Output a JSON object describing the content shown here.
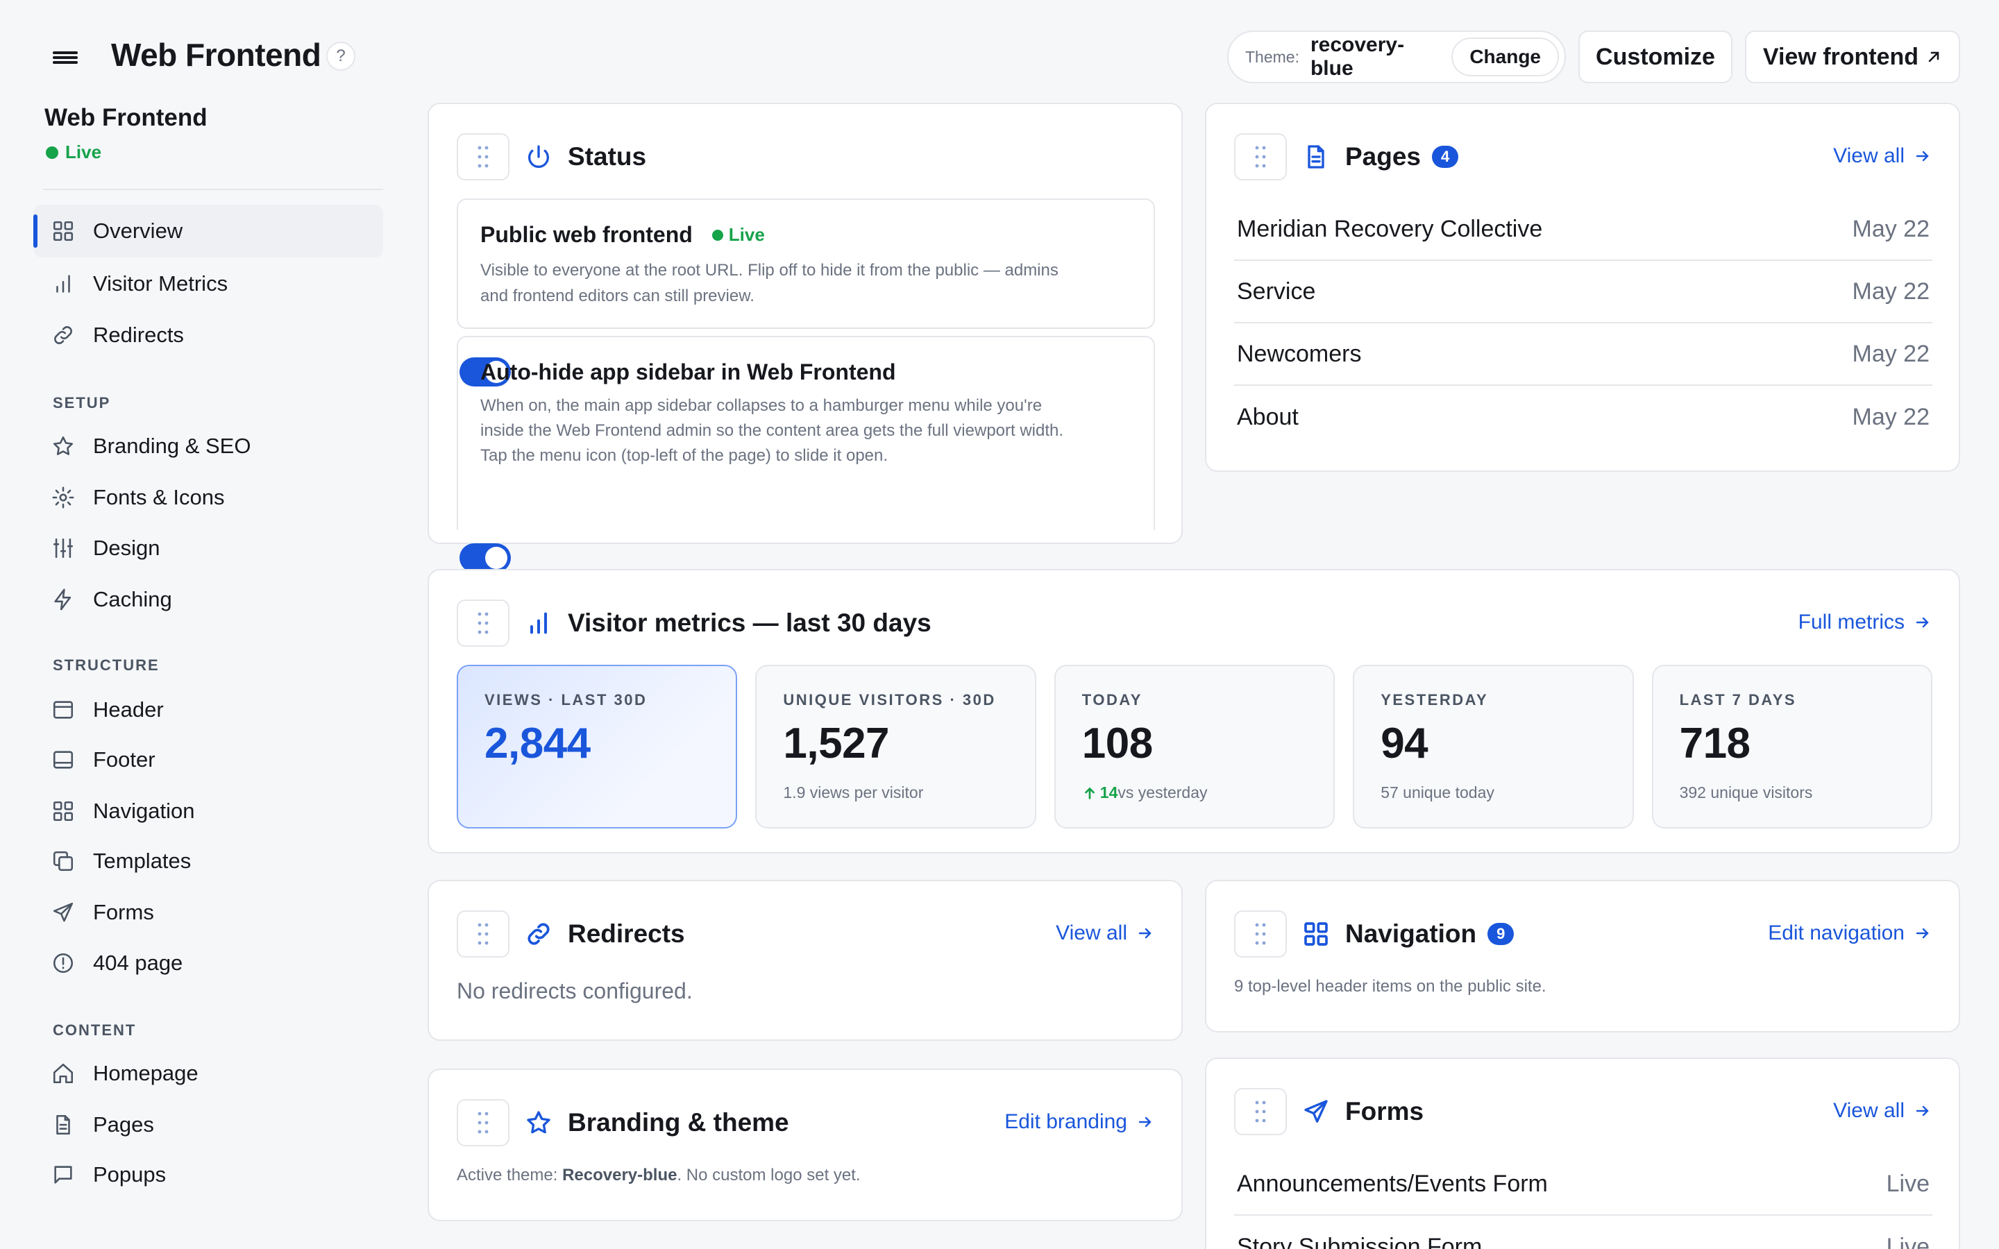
{
  "header": {
    "title": "Web Frontend",
    "help": "?",
    "theme_label": "Theme:",
    "theme_value": "recovery-blue",
    "change": "Change",
    "customize": "Customize",
    "view_frontend": "View frontend"
  },
  "sidebar": {
    "title": "Web Frontend",
    "status": "Live",
    "items": [
      {
        "label": "Overview",
        "icon": "grid-icon"
      },
      {
        "label": "Visitor Metrics",
        "icon": "bar-chart-icon"
      },
      {
        "label": "Redirects",
        "icon": "link-icon"
      }
    ],
    "setup_heading": "SETUP",
    "setup": [
      {
        "label": "Branding & SEO",
        "icon": "star-icon"
      },
      {
        "label": "Fonts & Icons",
        "icon": "gear-icon"
      },
      {
        "label": "Design",
        "icon": "sliders-icon"
      },
      {
        "label": "Caching",
        "icon": "bolt-icon"
      }
    ],
    "structure_heading": "STRUCTURE",
    "structure": [
      {
        "label": "Header",
        "icon": "header-icon"
      },
      {
        "label": "Footer",
        "icon": "footer-icon"
      },
      {
        "label": "Navigation",
        "icon": "grid-icon"
      },
      {
        "label": "Templates",
        "icon": "copy-icon"
      },
      {
        "label": "Forms",
        "icon": "send-icon"
      },
      {
        "label": "404 page",
        "icon": "alert-icon"
      }
    ],
    "content_heading": "CONTENT",
    "content": [
      {
        "label": "Homepage",
        "icon": "home-icon"
      },
      {
        "label": "Pages",
        "icon": "document-icon"
      },
      {
        "label": "Popups",
        "icon": "message-icon"
      }
    ]
  },
  "status_card": {
    "title": "Status",
    "items": [
      {
        "title": "Public web frontend",
        "badge": "Live",
        "desc": "Visible to everyone at the root URL. Flip off to hide it from the public — admins and frontend editors can still preview.",
        "on": true
      },
      {
        "title": "Auto-hide app sidebar in Web Frontend",
        "desc": "When on, the main app sidebar collapses to a hamburger menu while you're inside the Web Frontend admin so the content area gets the full viewport width. Tap the menu icon (top-left of the page) to slide it open.",
        "on": true
      }
    ]
  },
  "pages_card": {
    "title": "Pages",
    "count": "4",
    "link": "View all",
    "rows": [
      {
        "name": "Meridian Recovery Collective",
        "date": "May 22"
      },
      {
        "name": "Service",
        "date": "May 22"
      },
      {
        "name": "Newcomers",
        "date": "May 22"
      },
      {
        "name": "About",
        "date": "May 22"
      }
    ]
  },
  "metrics_card": {
    "title": "Visitor metrics — last 30 days",
    "link": "Full metrics",
    "tiles": [
      {
        "k": "VIEWS · LAST 30D",
        "v": "2,844",
        "s": ""
      },
      {
        "k": "UNIQUE VISITORS · 30D",
        "v": "1,527",
        "s": "1.9 views per visitor"
      },
      {
        "k": "TODAY",
        "v": "108",
        "delta": "14",
        "s": "vs yesterday"
      },
      {
        "k": "YESTERDAY",
        "v": "94",
        "s": "57 unique today"
      },
      {
        "k": "LAST 7 DAYS",
        "v": "718",
        "s": "392 unique visitors"
      }
    ]
  },
  "redirects_card": {
    "title": "Redirects",
    "link": "View all",
    "empty": "No redirects configured."
  },
  "navigation_card": {
    "title": "Navigation",
    "count": "9",
    "link": "Edit navigation",
    "desc": "9 top-level header items on the public site."
  },
  "branding_card": {
    "title": "Branding & theme",
    "link": "Edit branding",
    "desc_prefix": "Active theme: ",
    "theme": "Recovery-blue",
    "desc_suffix": ". No custom logo set yet."
  },
  "forms_card": {
    "title": "Forms",
    "link": "View all",
    "rows": [
      {
        "name": "Announcements/Events Form",
        "status": "Live"
      },
      {
        "name": "Story Submission Form",
        "status": "Live"
      }
    ]
  },
  "colors": {
    "accent": "#1a56db",
    "live": "#16a34a",
    "bg": "#f6f7f9"
  }
}
